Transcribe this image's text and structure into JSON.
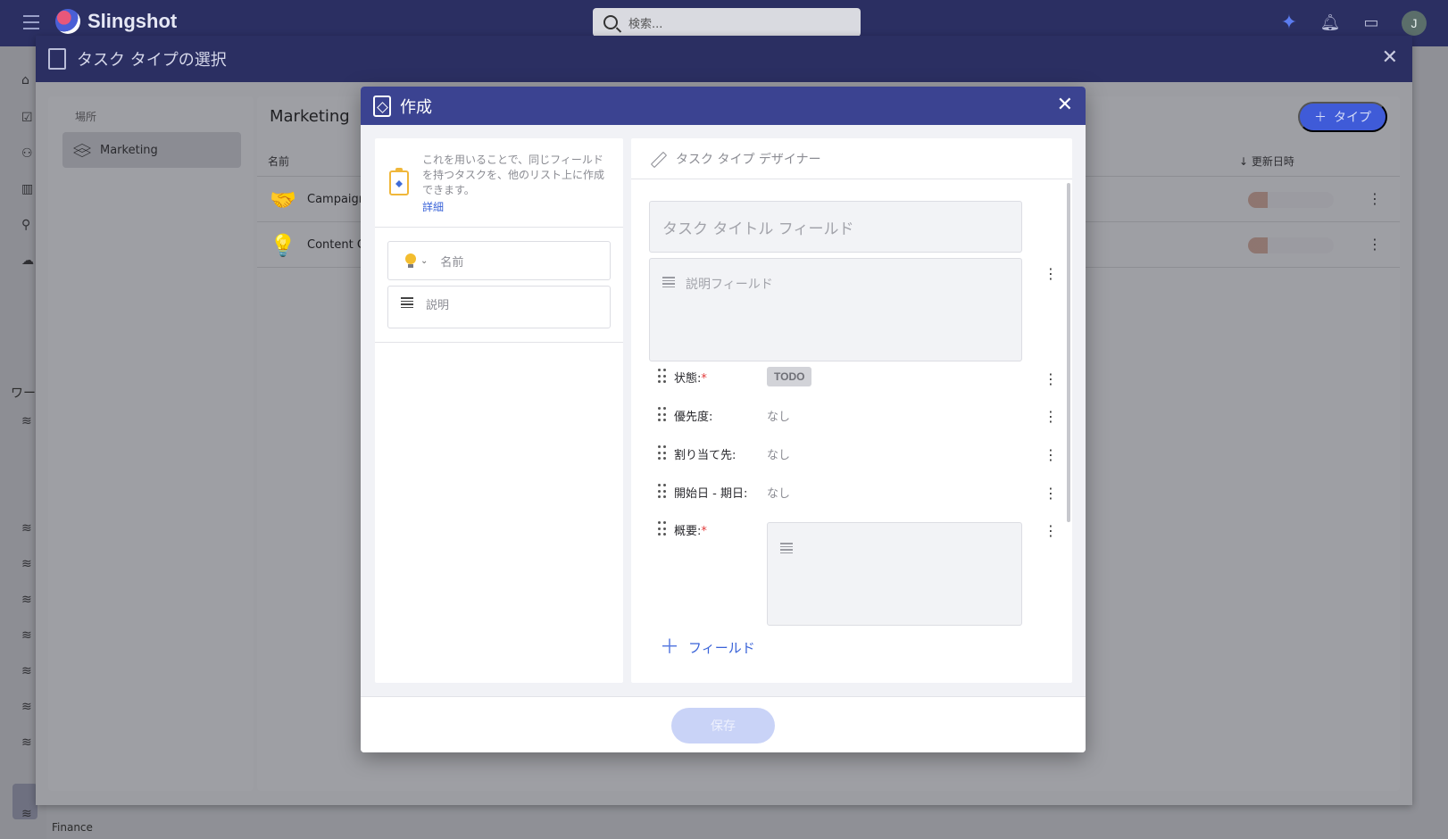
{
  "app": {
    "name": "Slingshot"
  },
  "topbar": {
    "search_placeholder": "検索...",
    "avatar_initial": "J"
  },
  "rail": {
    "workspaces_label": "ワー",
    "finance_label": "Finance"
  },
  "select_dialog": {
    "title": "タスク タイプの選択",
    "location_label": "場所",
    "location_item": "Marketing",
    "list_title": "Marketing",
    "add_type_label": "タイプ",
    "columns": {
      "name": "名前",
      "updated": "↓ 更新日時"
    },
    "rows": [
      {
        "name": "Campaign"
      },
      {
        "name": "Content C"
      }
    ]
  },
  "create_dialog": {
    "title": "作成",
    "info_text": "これを用いることで、同じフィールドを持つタスクを、他のリスト上に作成できます。",
    "info_link": "詳細",
    "name_placeholder": "名前",
    "desc_placeholder": "説明",
    "designer_title": "タスク タイプ デザイナー",
    "title_field_placeholder": "タスク タイトル フィールド",
    "desc_field_placeholder": "説明フィールド",
    "fields": [
      {
        "label": "状態:",
        "required": true,
        "value": "TODO"
      },
      {
        "label": "優先度:",
        "required": false,
        "value": "なし"
      },
      {
        "label": "割り当て先:",
        "required": false,
        "value": "なし"
      },
      {
        "label": "開始日 - 期日:",
        "required": false,
        "value": "なし"
      },
      {
        "label": "概要:",
        "required": true,
        "value": ""
      }
    ],
    "add_field_label": "フィールド",
    "save_label": "保存"
  },
  "colors": {
    "header": "#3b4391",
    "accent": "#3a63d8",
    "required": "#e23b3b"
  }
}
